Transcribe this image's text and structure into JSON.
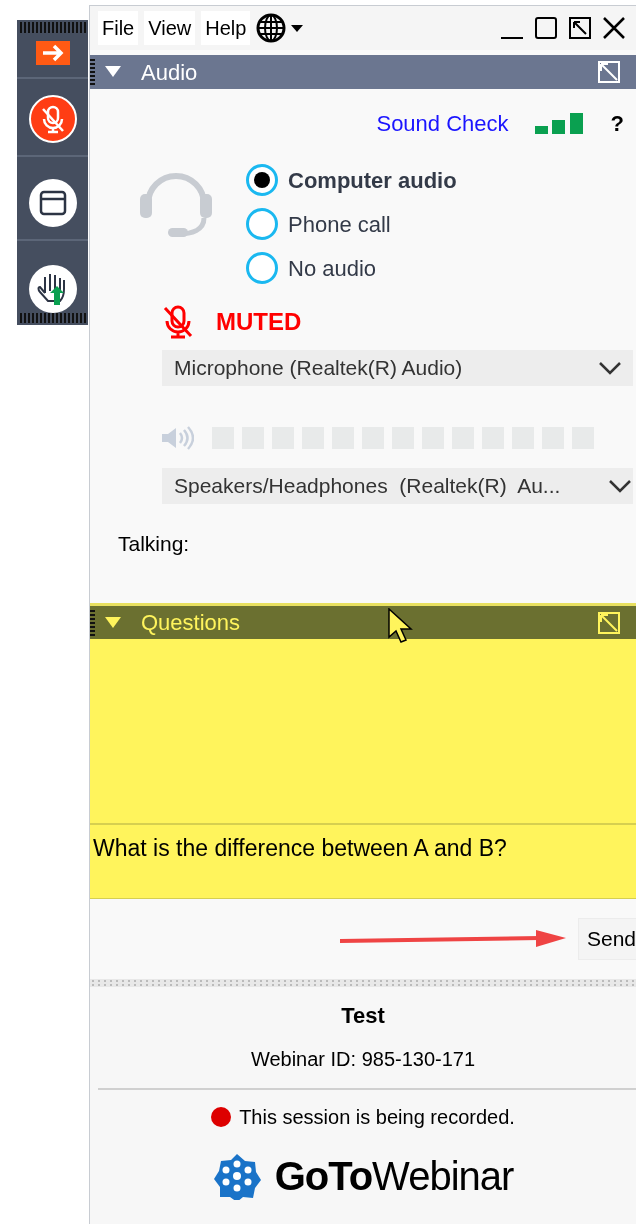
{
  "menu": [
    "File",
    "View",
    "Help"
  ],
  "toolbar": {
    "muted": true
  },
  "audio": {
    "title": "Audio",
    "sound_check": "Sound Check",
    "help": "?",
    "options": [
      {
        "label": "Computer audio",
        "selected": true
      },
      {
        "label": "Phone call",
        "selected": false
      },
      {
        "label": "No audio",
        "selected": false
      }
    ],
    "mic_status": {
      "label": "MUTED",
      "muted": true
    },
    "microphone": "Microphone (Realtek(R) Audio)",
    "speakers": "Speakers/Headphones  (Realtek(R)  Au...",
    "talking": "Talking:"
  },
  "questions": {
    "title": "Questions",
    "input": "What is the difference between A and B?",
    "send": "Send"
  },
  "footer": {
    "title": "Test",
    "webinar_id": "Webinar ID: 985-130-171",
    "recording": "This session is being recorded.",
    "logo": "**GoTo**Webinar"
  }
}
